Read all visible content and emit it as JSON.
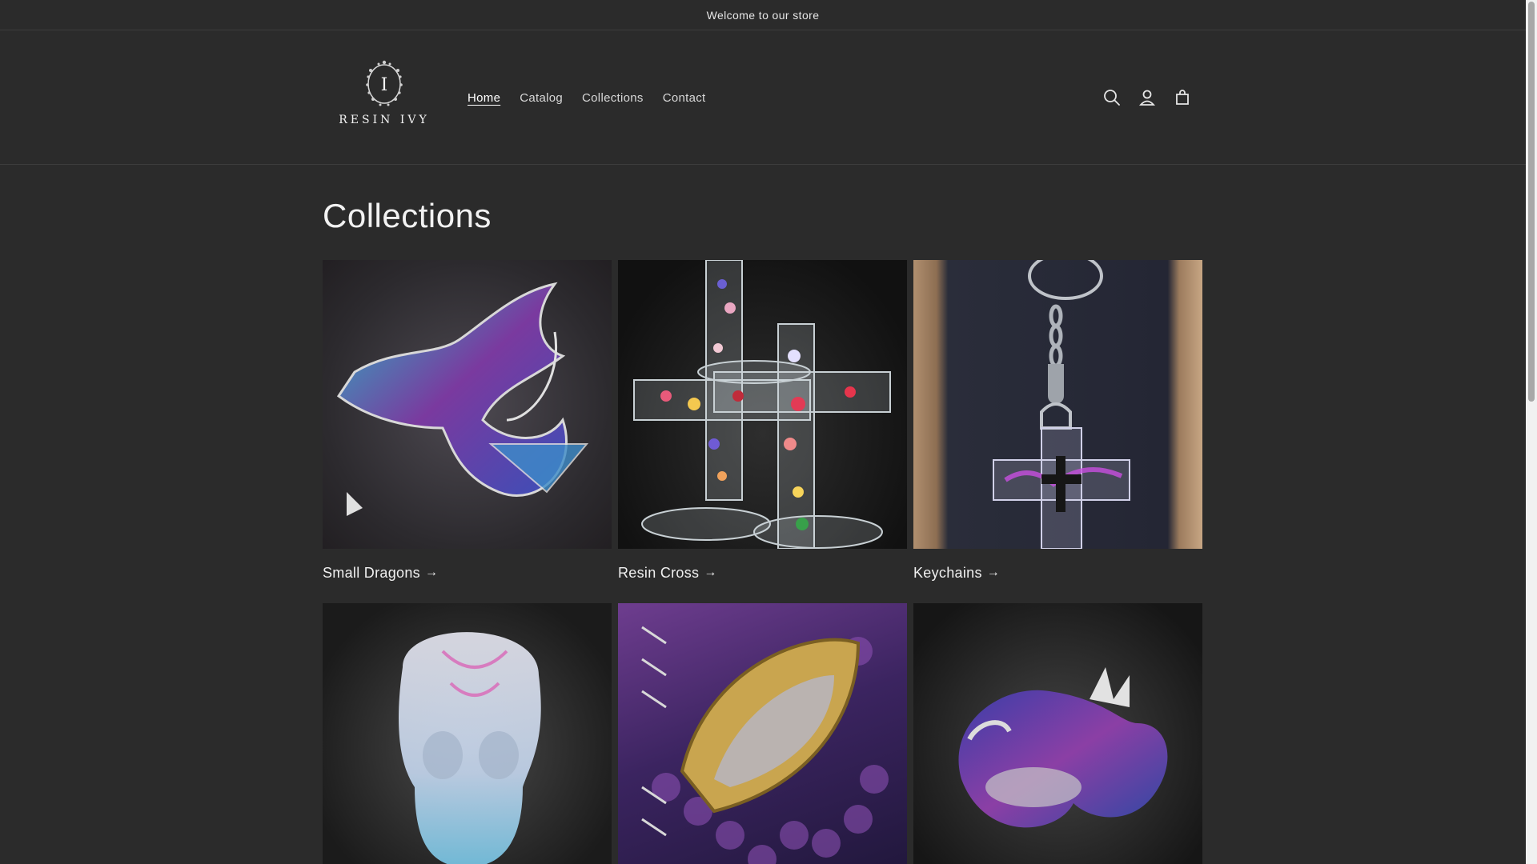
{
  "announcement": {
    "text": "Welcome to our store"
  },
  "header": {
    "logo_text": "RESIN IVY",
    "logo_letter": "I",
    "nav": [
      {
        "label": "Home",
        "active": true
      },
      {
        "label": "Catalog",
        "active": false
      },
      {
        "label": "Collections",
        "active": false
      },
      {
        "label": "Contact",
        "active": false
      }
    ],
    "icons": [
      "search-icon",
      "account-icon",
      "cart-icon"
    ]
  },
  "main": {
    "title": "Collections",
    "collections": [
      {
        "label": "Small Dragons",
        "image": "teal-purple-dragon"
      },
      {
        "label": "Resin Cross",
        "image": "floral-resin-crosses"
      },
      {
        "label": "Keychains",
        "image": "cross-keychain"
      },
      {
        "label": "",
        "image": "resin-skull"
      },
      {
        "label": "",
        "image": "dragon-eye-notebook"
      },
      {
        "label": "",
        "image": "curled-dragon"
      }
    ]
  },
  "colors": {
    "background": "#2b2b2b",
    "text": "#ececec",
    "border": "#3d3d3d"
  }
}
